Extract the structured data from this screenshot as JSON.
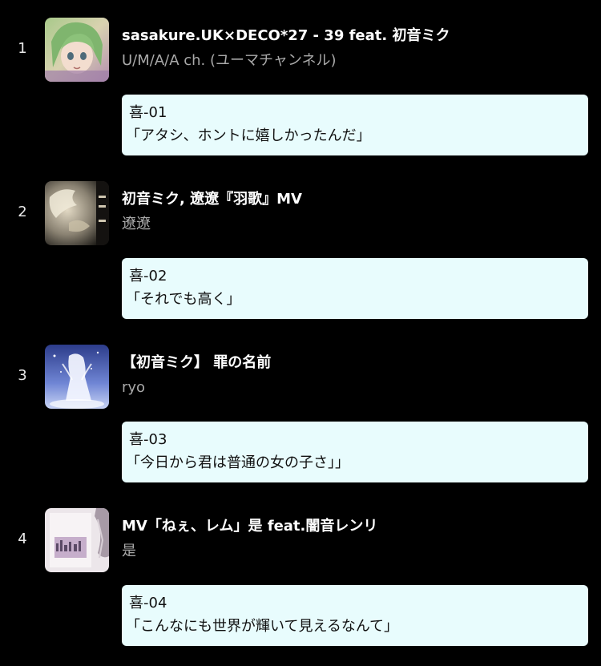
{
  "colors": {
    "background": "#000000",
    "title": "#ffffff",
    "artist": "#a9a9a9",
    "card_background": "#e8fcfd",
    "card_text": "#111111"
  },
  "entries": [
    {
      "rank": "1",
      "title": "sasakure.UK×DECO*27 - 39 feat. 初音ミク",
      "artist": "U/M/A/A ch. (ユーマチャンネル)",
      "code": "喜-01",
      "quote": "「アタシ、ホントに嬉しかったんだ」"
    },
    {
      "rank": "2",
      "title": "初音ミク, 遼遼『羽歌』MV",
      "artist": "遼遼",
      "code": "喜-02",
      "quote": "「それでも高く」"
    },
    {
      "rank": "3",
      "title": "【初音ミク】 罪の名前",
      "artist": "ryo",
      "code": "喜-03",
      "quote": "「今日から君は普通の女の子さ」」"
    },
    {
      "rank": "4",
      "title": "MV「ねぇ、レム」是 feat.闇音レンリ",
      "artist": "是",
      "code": "喜-04",
      "quote": "「こんなにも世界が輝いて見えるなんて」"
    }
  ]
}
